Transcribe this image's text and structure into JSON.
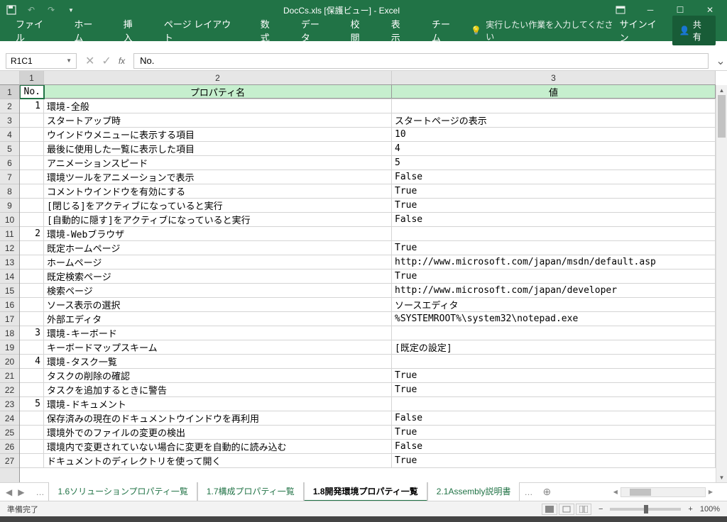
{
  "title": "DocCs.xls [保護ビュー] - Excel",
  "ribbon": {
    "tabs": [
      "ファイル",
      "ホーム",
      "挿入",
      "ページ レイアウト",
      "数式",
      "データ",
      "校閲",
      "表示",
      "チーム"
    ],
    "tellme": "実行したい作業を入力してください",
    "signin": "サインイン",
    "share": "共有"
  },
  "formula_bar": {
    "name_box": "R1C1",
    "value": "No."
  },
  "columns": [
    "1",
    "2",
    "3"
  ],
  "header_row": {
    "no": "No.",
    "name": "プロパティ名",
    "value": "値"
  },
  "rows": [
    {
      "n": "1",
      "no": "1",
      "name": "環境-全般",
      "value": ""
    },
    {
      "n": "2",
      "no": "",
      "name": "スタートアップ時",
      "value": "スタートページの表示"
    },
    {
      "n": "3",
      "no": "",
      "name": "ウインドウメニューに表示する項目",
      "value": "10"
    },
    {
      "n": "4",
      "no": "",
      "name": "最後に使用した一覧に表示した項目",
      "value": "4"
    },
    {
      "n": "5",
      "no": "",
      "name": "アニメーションスピード",
      "value": "5"
    },
    {
      "n": "6",
      "no": "",
      "name": "環境ツールをアニメーションで表示",
      "value": "False"
    },
    {
      "n": "7",
      "no": "",
      "name": "コメントウインドウを有効にする",
      "value": "True"
    },
    {
      "n": "8",
      "no": "",
      "name": "[閉じる]をアクティブになっていると実行",
      "value": "True"
    },
    {
      "n": "9",
      "no": "",
      "name": "[自動的に隠す]をアクティブになっていると実行",
      "value": "False"
    },
    {
      "n": "10",
      "no": "2",
      "name": "環境-Webブラウザ",
      "value": ""
    },
    {
      "n": "11",
      "no": "",
      "name": "既定ホームページ",
      "value": "True"
    },
    {
      "n": "12",
      "no": "",
      "name": "ホームページ",
      "value": "http://www.microsoft.com/japan/msdn/default.asp"
    },
    {
      "n": "13",
      "no": "",
      "name": "既定検索ページ",
      "value": "True"
    },
    {
      "n": "14",
      "no": "",
      "name": "検索ページ",
      "value": "http://www.microsoft.com/japan/developer"
    },
    {
      "n": "15",
      "no": "",
      "name": "ソース表示の選択",
      "value": "ソースエディタ"
    },
    {
      "n": "16",
      "no": "",
      "name": "外部エディタ",
      "value": "%SYSTEMROOT%\\system32\\notepad.exe"
    },
    {
      "n": "17",
      "no": "3",
      "name": "環境-キーボード",
      "value": ""
    },
    {
      "n": "18",
      "no": "",
      "name": "キーボードマップスキーム",
      "value": "[既定の設定]"
    },
    {
      "n": "19",
      "no": "4",
      "name": "環境-タスク一覧",
      "value": ""
    },
    {
      "n": "20",
      "no": "",
      "name": "タスクの削除の確認",
      "value": "True"
    },
    {
      "n": "21",
      "no": "",
      "name": "タスクを追加するときに警告",
      "value": "True"
    },
    {
      "n": "22",
      "no": "5",
      "name": "環境-ドキュメント",
      "value": ""
    },
    {
      "n": "23",
      "no": "",
      "name": "保存済みの現在のドキュメントウインドウを再利用",
      "value": "False"
    },
    {
      "n": "24",
      "no": "",
      "name": "環境外でのファイルの変更の検出",
      "value": "True"
    },
    {
      "n": "25",
      "no": "",
      "name": "環境内で変更されていない場合に変更を自動的に読み込む",
      "value": "False"
    },
    {
      "n": "26",
      "no": "",
      "name": "ドキュメントのディレクトリを使って開く",
      "value": "True"
    }
  ],
  "sheet_tabs": [
    "1.6ソリューションプロパティ一覧",
    "1.7構成プロパティ一覧",
    "1.8開発環境プロパティ一覧",
    "2.1Assembly説明書"
  ],
  "active_sheet": 2,
  "status": {
    "left": "準備完了",
    "zoom": "100%"
  },
  "chart_data": {
    "type": "table",
    "title": "1.8開発環境プロパティ一覧",
    "columns": [
      "No.",
      "プロパティ名",
      "値"
    ],
    "sections": [
      {
        "no": 1,
        "section": "環境-全般",
        "properties": [
          {
            "name": "スタートアップ時",
            "value": "スタートページの表示"
          },
          {
            "name": "ウインドウメニューに表示する項目",
            "value": 10
          },
          {
            "name": "最後に使用した一覧に表示した項目",
            "value": 4
          },
          {
            "name": "アニメーションスピード",
            "value": 5
          },
          {
            "name": "環境ツールをアニメーションで表示",
            "value": false
          },
          {
            "name": "コメントウインドウを有効にする",
            "value": true
          },
          {
            "name": "[閉じる]をアクティブになっていると実行",
            "value": true
          },
          {
            "name": "[自動的に隠す]をアクティブになっていると実行",
            "value": false
          }
        ]
      },
      {
        "no": 2,
        "section": "環境-Webブラウザ",
        "properties": [
          {
            "name": "既定ホームページ",
            "value": true
          },
          {
            "name": "ホームページ",
            "value": "http://www.microsoft.com/japan/msdn/default.asp"
          },
          {
            "name": "既定検索ページ",
            "value": true
          },
          {
            "name": "検索ページ",
            "value": "http://www.microsoft.com/japan/developer"
          },
          {
            "name": "ソース表示の選択",
            "value": "ソースエディタ"
          },
          {
            "name": "外部エディタ",
            "value": "%SYSTEMROOT%\\system32\\notepad.exe"
          }
        ]
      },
      {
        "no": 3,
        "section": "環境-キーボード",
        "properties": [
          {
            "name": "キーボードマップスキーム",
            "value": "[既定の設定]"
          }
        ]
      },
      {
        "no": 4,
        "section": "環境-タスク一覧",
        "properties": [
          {
            "name": "タスクの削除の確認",
            "value": true
          },
          {
            "name": "タスクを追加するときに警告",
            "value": true
          }
        ]
      },
      {
        "no": 5,
        "section": "環境-ドキュメント",
        "properties": [
          {
            "name": "保存済みの現在のドキュメントウインドウを再利用",
            "value": false
          },
          {
            "name": "環境外でのファイルの変更の検出",
            "value": true
          },
          {
            "name": "環境内で変更されていない場合に変更を自動的に読み込む",
            "value": false
          },
          {
            "name": "ドキュメントのディレクトリを使って開く",
            "value": true
          }
        ]
      }
    ]
  }
}
